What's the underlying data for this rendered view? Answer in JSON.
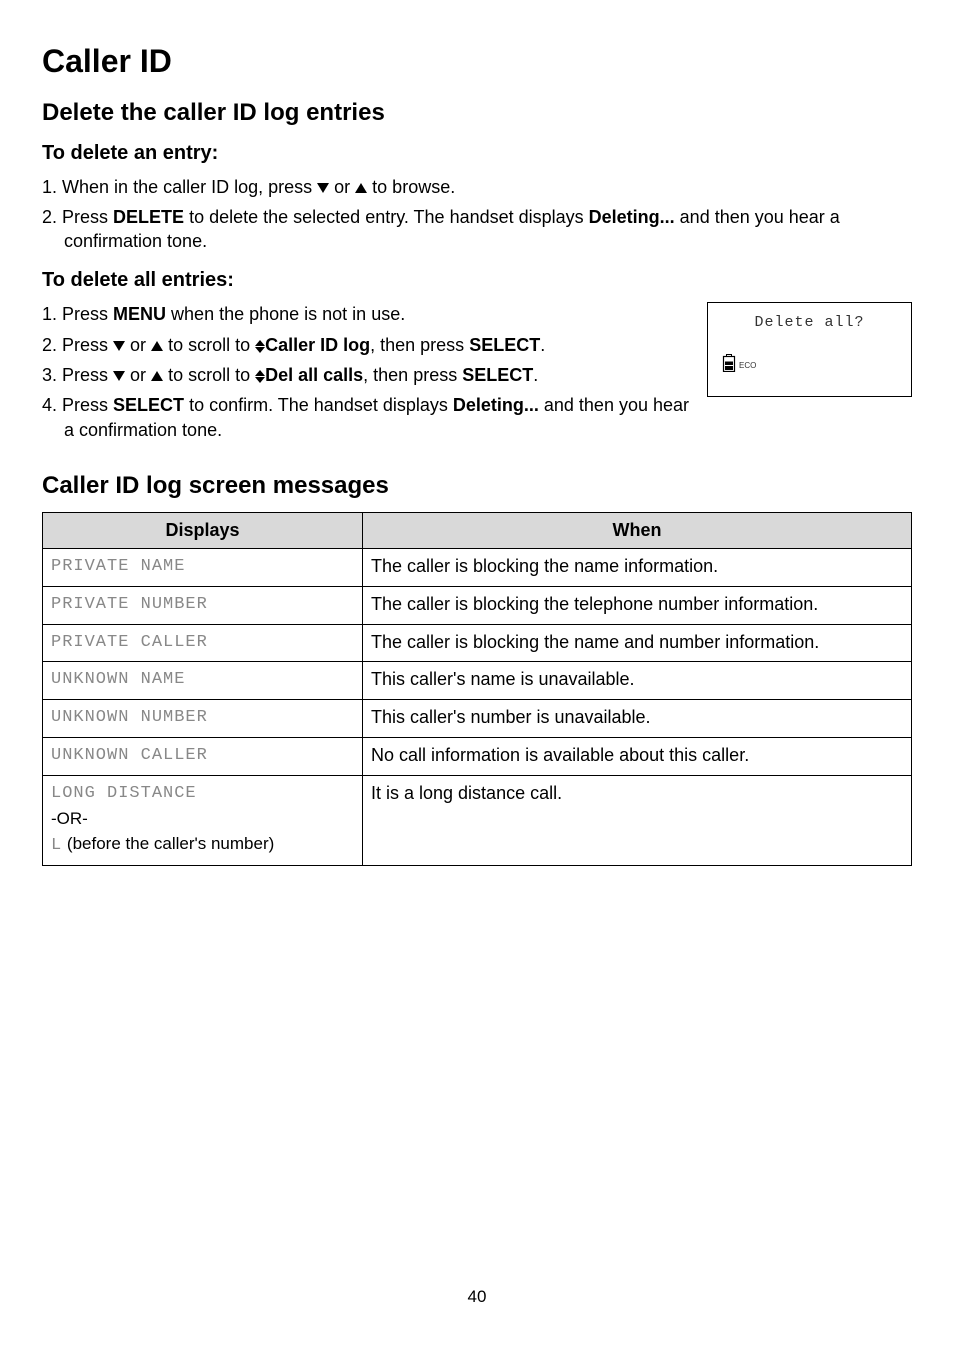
{
  "page_title": "Caller ID",
  "section1": {
    "title": "Delete the caller ID log entries",
    "sub1_title": "To delete an entry:",
    "sub1_items": {
      "i1_num": "1.",
      "i1_a": "When in the caller ID log, press ",
      "i1_b": " or ",
      "i1_c": " to browse.",
      "i2_num": "2.",
      "i2_a": "Press ",
      "i2_b": "DELETE",
      "i2_c": " to delete the selected entry. The handset displays ",
      "i2_d": "Deleting...",
      "i2_e": " and then you hear a confirmation tone."
    },
    "sub2_title": "To delete all entries:",
    "sub2_items": {
      "i1_num": "1.",
      "i1_a": "Press ",
      "i1_b": "MENU",
      "i1_c": " when the phone is not in use.",
      "i2_num": "2.",
      "i2_a": "Press ",
      "i2_b": " or ",
      "i2_c": " to scroll to ",
      "i2_d": "Caller ID log",
      "i2_e": ", then press ",
      "i2_f": "SELECT",
      "i2_g": ".",
      "i3_num": "3.",
      "i3_a": "Press ",
      "i3_b": " or ",
      "i3_c": " to scroll to ",
      "i3_d": "Del all calls",
      "i3_e": ", then press ",
      "i3_f": "SELECT",
      "i3_g": ".",
      "i4_num": "4.",
      "i4_a": "Press ",
      "i4_b": "SELECT",
      "i4_c": " to confirm. The handset displays ",
      "i4_d": "Deleting...",
      "i4_e": " and then you hear a confirmation tone."
    }
  },
  "handset": {
    "title": "Delete all?",
    "eco": "ECO"
  },
  "section2": {
    "title": "Caller ID log screen messages",
    "table": {
      "header_displays": "Displays",
      "header_when": "When",
      "rows": [
        {
          "d": "PRIVATE NAME",
          "w": "The caller is blocking the name information."
        },
        {
          "d": "PRIVATE NUMBER",
          "w": "The caller is blocking the telephone number information."
        },
        {
          "d": "PRIVATE CALLER",
          "w": "The caller is blocking the name and number information."
        },
        {
          "d": "UNKNOWN NAME",
          "w": "This caller's name is unavailable."
        },
        {
          "d": "UNKNOWN NUMBER",
          "w": "This caller's number is unavailable."
        },
        {
          "d": "UNKNOWN CALLER",
          "w": "No call information is available about this caller."
        },
        {
          "d": "LONG DISTANCE",
          "w": "It is a long distance call."
        }
      ],
      "row7_sub1": "-OR-",
      "row7_sub2a": "L",
      "row7_sub2b": " (before the caller's number)"
    }
  },
  "page_number": "40"
}
